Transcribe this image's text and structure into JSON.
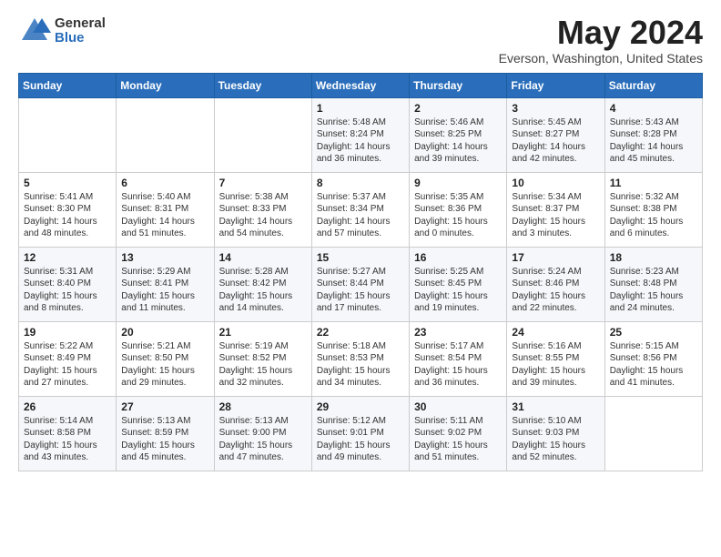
{
  "header": {
    "logo_general": "General",
    "logo_blue": "Blue",
    "title": "May 2024",
    "location": "Everson, Washington, United States"
  },
  "columns": [
    "Sunday",
    "Monday",
    "Tuesday",
    "Wednesday",
    "Thursday",
    "Friday",
    "Saturday"
  ],
  "weeks": [
    [
      {
        "day": "",
        "info": ""
      },
      {
        "day": "",
        "info": ""
      },
      {
        "day": "",
        "info": ""
      },
      {
        "day": "1",
        "info": "Sunrise: 5:48 AM\nSunset: 8:24 PM\nDaylight: 14 hours\nand 36 minutes."
      },
      {
        "day": "2",
        "info": "Sunrise: 5:46 AM\nSunset: 8:25 PM\nDaylight: 14 hours\nand 39 minutes."
      },
      {
        "day": "3",
        "info": "Sunrise: 5:45 AM\nSunset: 8:27 PM\nDaylight: 14 hours\nand 42 minutes."
      },
      {
        "day": "4",
        "info": "Sunrise: 5:43 AM\nSunset: 8:28 PM\nDaylight: 14 hours\nand 45 minutes."
      }
    ],
    [
      {
        "day": "5",
        "info": "Sunrise: 5:41 AM\nSunset: 8:30 PM\nDaylight: 14 hours\nand 48 minutes."
      },
      {
        "day": "6",
        "info": "Sunrise: 5:40 AM\nSunset: 8:31 PM\nDaylight: 14 hours\nand 51 minutes."
      },
      {
        "day": "7",
        "info": "Sunrise: 5:38 AM\nSunset: 8:33 PM\nDaylight: 14 hours\nand 54 minutes."
      },
      {
        "day": "8",
        "info": "Sunrise: 5:37 AM\nSunset: 8:34 PM\nDaylight: 14 hours\nand 57 minutes."
      },
      {
        "day": "9",
        "info": "Sunrise: 5:35 AM\nSunset: 8:36 PM\nDaylight: 15 hours\nand 0 minutes."
      },
      {
        "day": "10",
        "info": "Sunrise: 5:34 AM\nSunset: 8:37 PM\nDaylight: 15 hours\nand 3 minutes."
      },
      {
        "day": "11",
        "info": "Sunrise: 5:32 AM\nSunset: 8:38 PM\nDaylight: 15 hours\nand 6 minutes."
      }
    ],
    [
      {
        "day": "12",
        "info": "Sunrise: 5:31 AM\nSunset: 8:40 PM\nDaylight: 15 hours\nand 8 minutes."
      },
      {
        "day": "13",
        "info": "Sunrise: 5:29 AM\nSunset: 8:41 PM\nDaylight: 15 hours\nand 11 minutes."
      },
      {
        "day": "14",
        "info": "Sunrise: 5:28 AM\nSunset: 8:42 PM\nDaylight: 15 hours\nand 14 minutes."
      },
      {
        "day": "15",
        "info": "Sunrise: 5:27 AM\nSunset: 8:44 PM\nDaylight: 15 hours\nand 17 minutes."
      },
      {
        "day": "16",
        "info": "Sunrise: 5:25 AM\nSunset: 8:45 PM\nDaylight: 15 hours\nand 19 minutes."
      },
      {
        "day": "17",
        "info": "Sunrise: 5:24 AM\nSunset: 8:46 PM\nDaylight: 15 hours\nand 22 minutes."
      },
      {
        "day": "18",
        "info": "Sunrise: 5:23 AM\nSunset: 8:48 PM\nDaylight: 15 hours\nand 24 minutes."
      }
    ],
    [
      {
        "day": "19",
        "info": "Sunrise: 5:22 AM\nSunset: 8:49 PM\nDaylight: 15 hours\nand 27 minutes."
      },
      {
        "day": "20",
        "info": "Sunrise: 5:21 AM\nSunset: 8:50 PM\nDaylight: 15 hours\nand 29 minutes."
      },
      {
        "day": "21",
        "info": "Sunrise: 5:19 AM\nSunset: 8:52 PM\nDaylight: 15 hours\nand 32 minutes."
      },
      {
        "day": "22",
        "info": "Sunrise: 5:18 AM\nSunset: 8:53 PM\nDaylight: 15 hours\nand 34 minutes."
      },
      {
        "day": "23",
        "info": "Sunrise: 5:17 AM\nSunset: 8:54 PM\nDaylight: 15 hours\nand 36 minutes."
      },
      {
        "day": "24",
        "info": "Sunrise: 5:16 AM\nSunset: 8:55 PM\nDaylight: 15 hours\nand 39 minutes."
      },
      {
        "day": "25",
        "info": "Sunrise: 5:15 AM\nSunset: 8:56 PM\nDaylight: 15 hours\nand 41 minutes."
      }
    ],
    [
      {
        "day": "26",
        "info": "Sunrise: 5:14 AM\nSunset: 8:58 PM\nDaylight: 15 hours\nand 43 minutes."
      },
      {
        "day": "27",
        "info": "Sunrise: 5:13 AM\nSunset: 8:59 PM\nDaylight: 15 hours\nand 45 minutes."
      },
      {
        "day": "28",
        "info": "Sunrise: 5:13 AM\nSunset: 9:00 PM\nDaylight: 15 hours\nand 47 minutes."
      },
      {
        "day": "29",
        "info": "Sunrise: 5:12 AM\nSunset: 9:01 PM\nDaylight: 15 hours\nand 49 minutes."
      },
      {
        "day": "30",
        "info": "Sunrise: 5:11 AM\nSunset: 9:02 PM\nDaylight: 15 hours\nand 51 minutes."
      },
      {
        "day": "31",
        "info": "Sunrise: 5:10 AM\nSunset: 9:03 PM\nDaylight: 15 hours\nand 52 minutes."
      },
      {
        "day": "",
        "info": ""
      }
    ]
  ]
}
